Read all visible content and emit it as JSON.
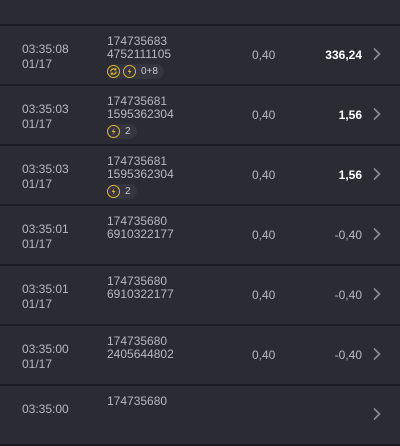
{
  "rows": [
    {
      "time": "",
      "date": "",
      "id1": "",
      "id2": "",
      "badge": "0+8",
      "stake": "",
      "payout": "",
      "win": false,
      "icons": 2
    },
    {
      "time": "03:35:08",
      "date": "01/17",
      "id1": "174735683",
      "id2": "4752111105",
      "badge": "0+8",
      "stake": "0,40",
      "payout": "336,24",
      "win": true,
      "icons": 2
    },
    {
      "time": "03:35:03",
      "date": "01/17",
      "id1": "174735681",
      "id2": "1595362304",
      "badge": "2",
      "stake": "0,40",
      "payout": "1,56",
      "win": true,
      "icons": 1
    },
    {
      "time": "03:35:03",
      "date": "01/17",
      "id1": "174735681",
      "id2": "1595362304",
      "badge": "2",
      "stake": "0,40",
      "payout": "1,56",
      "win": true,
      "icons": 1
    },
    {
      "time": "03:35:01",
      "date": "01/17",
      "id1": "174735680",
      "id2": "6910322177",
      "badge": "",
      "stake": "0,40",
      "payout": "-0,40",
      "win": false,
      "icons": 0
    },
    {
      "time": "03:35:01",
      "date": "01/17",
      "id1": "174735680",
      "id2": "6910322177",
      "badge": "",
      "stake": "0,40",
      "payout": "-0,40",
      "win": false,
      "icons": 0
    },
    {
      "time": "03:35:00",
      "date": "01/17",
      "id1": "174735680",
      "id2": "2405644802",
      "badge": "",
      "stake": "0,40",
      "payout": "-0,40",
      "win": false,
      "icons": 0
    },
    {
      "time": "03:35:00",
      "date": "",
      "id1": "174735680",
      "id2": "",
      "badge": "",
      "stake": "",
      "payout": "",
      "win": false,
      "icons": 0
    }
  ],
  "colors": {
    "background": "#1b1c23",
    "row": "#2a2b33",
    "accent": "#e2b62a",
    "win_text": "#ffffff"
  },
  "icons": {
    "spin": "refresh-icon",
    "bonus": "bolt-coin-icon",
    "detail": "chevron-right-icon"
  }
}
